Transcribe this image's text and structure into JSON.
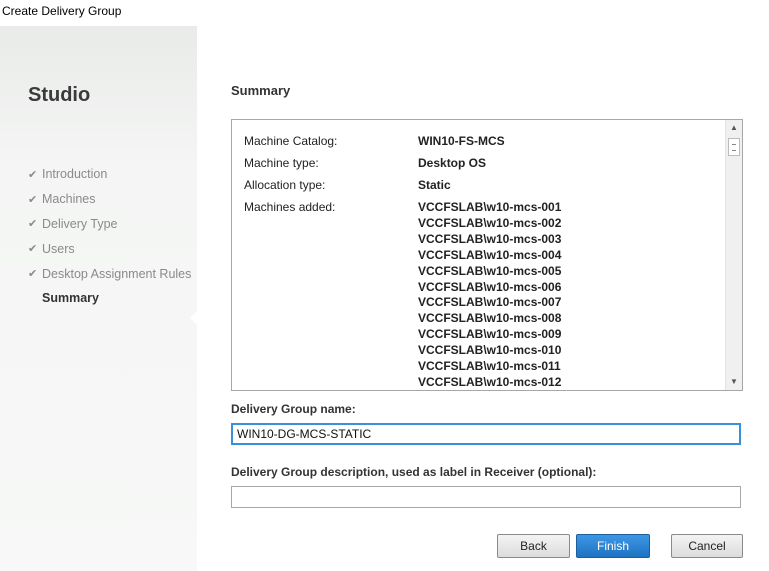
{
  "window": {
    "title": "Create Delivery Group"
  },
  "sidebar": {
    "brand": "Studio",
    "steps": [
      {
        "label": "Introduction",
        "done": true
      },
      {
        "label": "Machines",
        "done": true
      },
      {
        "label": "Delivery Type",
        "done": true
      },
      {
        "label": "Users",
        "done": true
      },
      {
        "label": "Desktop Assignment Rules",
        "done": true
      },
      {
        "label": "Summary",
        "done": false,
        "active": true
      }
    ]
  },
  "main": {
    "header": "Summary",
    "summary": {
      "rows": [
        {
          "key": "Machine Catalog:",
          "value": "WIN10-FS-MCS"
        },
        {
          "key": "Machine type:",
          "value": "Desktop OS"
        },
        {
          "key": "Allocation type:",
          "value": "Static"
        },
        {
          "key": "Machines added:",
          "value": ""
        }
      ],
      "machines": [
        "VCCFSLAB\\w10-mcs-001",
        "VCCFSLAB\\w10-mcs-002",
        "VCCFSLAB\\w10-mcs-003",
        "VCCFSLAB\\w10-mcs-004",
        "VCCFSLAB\\w10-mcs-005",
        "VCCFSLAB\\w10-mcs-006",
        "VCCFSLAB\\w10-mcs-007",
        "VCCFSLAB\\w10-mcs-008",
        "VCCFSLAB\\w10-mcs-009",
        "VCCFSLAB\\w10-mcs-010",
        "VCCFSLAB\\w10-mcs-011",
        "VCCFSLAB\\w10-mcs-012"
      ]
    },
    "name_label": "Delivery Group name:",
    "name_value": "WIN10-DG-MCS-STATIC",
    "desc_label": "Delivery Group description, used as label in Receiver (optional):",
    "desc_value": "",
    "buttons": {
      "back": "Back",
      "finish": "Finish",
      "cancel": "Cancel"
    }
  }
}
